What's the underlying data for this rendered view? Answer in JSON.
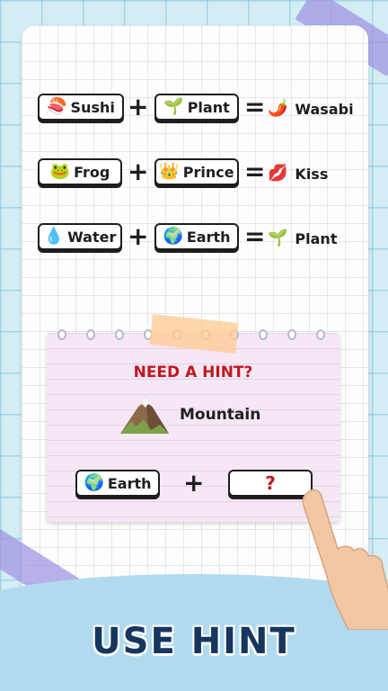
{
  "equations": [
    {
      "a": {
        "emoji": "🍣",
        "label": "Sushi"
      },
      "b": {
        "emoji": "🌱",
        "label": "Plant"
      },
      "result": {
        "emoji": "🌶️",
        "label": "Wasabi"
      }
    },
    {
      "a": {
        "emoji": "🐸",
        "label": "Frog"
      },
      "b": {
        "emoji": "👑",
        "label": "Prince"
      },
      "result": {
        "emoji": "💋",
        "label": "Kiss"
      }
    },
    {
      "a": {
        "emoji": "💧",
        "label": "Water"
      },
      "b": {
        "emoji": "🌍",
        "label": "Earth"
      },
      "result": {
        "emoji": "🌱",
        "label": "Plant"
      }
    }
  ],
  "operators": {
    "plus": "+",
    "equals": "="
  },
  "hint": {
    "title": "NEED A HINT?",
    "target": {
      "label": "Mountain"
    },
    "given": {
      "emoji": "🌍",
      "label": "Earth"
    },
    "unknown": "?"
  },
  "banner": "USE HINT",
  "colors": {
    "hint_title": "#c0181e",
    "banner_text": "#17365e",
    "note_bg": "#f6e7f5",
    "background": "#d4edf5"
  }
}
